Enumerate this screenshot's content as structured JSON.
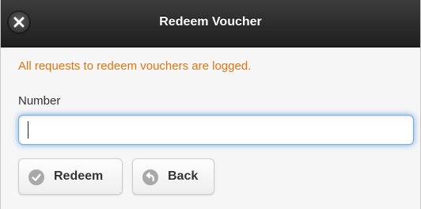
{
  "header": {
    "title": "Redeem Voucher",
    "close_icon": "close-icon"
  },
  "notice": {
    "text": "All requests to redeem vouchers are logged.",
    "color": "#e07412"
  },
  "form": {
    "number_label": "Number",
    "number_value": "",
    "number_placeholder": ""
  },
  "buttons": {
    "redeem_label": "Redeem",
    "redeem_icon": "check-icon",
    "back_label": "Back",
    "back_icon": "back-arrow-icon"
  }
}
